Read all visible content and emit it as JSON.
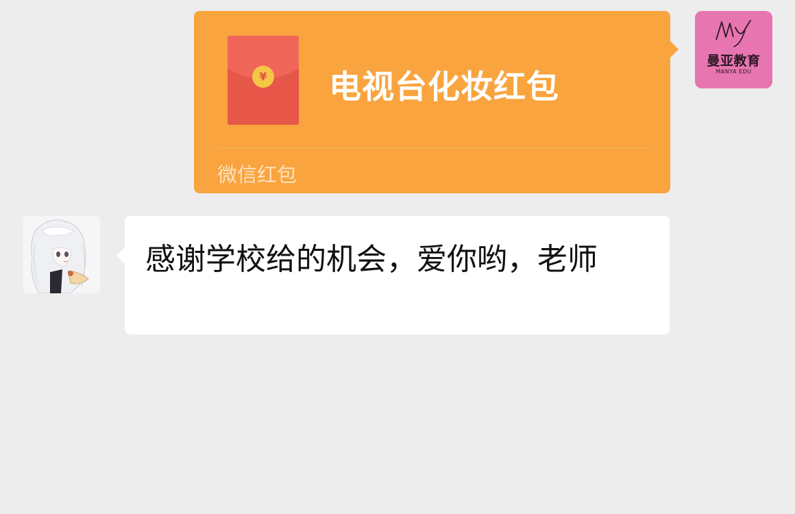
{
  "messages": {
    "red_packet": {
      "title": "电视台化妆红包",
      "footer": "微信红包",
      "coin_symbol": "¥",
      "colors": {
        "bubble": "#f9a43e",
        "envelope": "#e65649",
        "coin": "#f6c646"
      }
    },
    "sender_avatar": {
      "logo_name": "曼亚教育",
      "logo_sub": "MANYA EDU",
      "background": "#e775b0"
    },
    "reply": {
      "text": "感谢学校给的机会，爱你哟，老师",
      "avatar_icon": "anime-character-avatar"
    }
  },
  "theme": {
    "background": "#ededed",
    "bubble_white": "#ffffff"
  }
}
